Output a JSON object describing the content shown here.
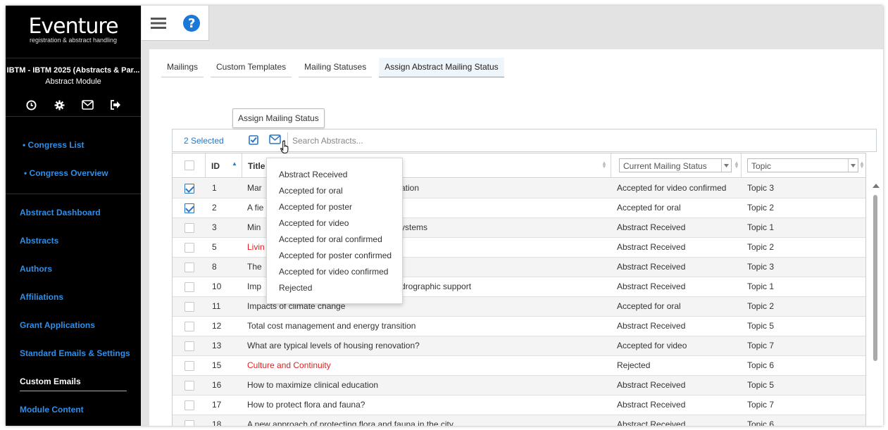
{
  "sidebar": {
    "logo_title": "Eventure",
    "logo_subtitle": "registration & abstract handling",
    "congress_name": "IBTM - IBTM 2025 (Abstracts & Par...",
    "module_name": "Abstract Module",
    "icons": [
      "clock-icon",
      "gear-icon",
      "mail-icon",
      "logout-icon"
    ],
    "links": {
      "congress_list": "• Congress List",
      "congress_overview": "• Congress Overview",
      "abstract_dashboard": "Abstract Dashboard",
      "abstracts": "Abstracts",
      "authors": "Authors",
      "affiliations": "Affiliations",
      "grant_applications": "Grant Applications",
      "standard_emails": "Standard Emails & Settings",
      "custom_emails": "Custom Emails",
      "module_content": "Module Content"
    },
    "active_link": "Custom Emails",
    "link_color": "#2f8fe8"
  },
  "topbar": {
    "icons": [
      "hamburger-icon",
      "help-icon"
    ],
    "help_glyph": "?"
  },
  "tabs": [
    {
      "label": "Mailings",
      "active": false
    },
    {
      "label": "Custom Templates",
      "active": false
    },
    {
      "label": "Mailing Statuses",
      "active": false
    },
    {
      "label": "Assign Abstract Mailing Status",
      "active": true
    }
  ],
  "toolbar": {
    "selected_text": "2 Selected",
    "search_placeholder": "Search Abstracts...",
    "tooltip": "Assign Mailing Status"
  },
  "grid": {
    "columns": {
      "id": "ID",
      "title": "Title",
      "status_filter": "Current Mailing Status",
      "topic_filter": "Topic"
    },
    "rows": [
      {
        "checked": true,
        "id": "1",
        "title": "Mar",
        "title_rest": "zation",
        "red": false,
        "status": "Accepted for video confirmed",
        "topic": "Topic 3"
      },
      {
        "checked": true,
        "id": "2",
        "title": "A fie",
        "title_rest": "",
        "red": false,
        "status": "Accepted for oral",
        "topic": "Topic 2"
      },
      {
        "checked": false,
        "id": "3",
        "title": "Min",
        "title_rest": "systems",
        "red": false,
        "status": "Abstract Received",
        "topic": "Topic 1"
      },
      {
        "checked": false,
        "id": "5",
        "title": "Livin",
        "title_rest": "",
        "red": true,
        "status": "Abstract Received",
        "topic": "Topic 2"
      },
      {
        "checked": false,
        "id": "8",
        "title": "The",
        "title_rest": "",
        "red": false,
        "status": "Abstract Received",
        "topic": "Topic 3"
      },
      {
        "checked": false,
        "id": "10",
        "title": "Imp",
        "title_rest": "ydrographic support",
        "red": false,
        "status": "Abstract Received",
        "topic": "Topic 1"
      },
      {
        "checked": false,
        "id": "11",
        "title": "Impacts of climate change",
        "title_rest": "",
        "red": false,
        "status": "Accepted for oral",
        "topic": "Topic 2"
      },
      {
        "checked": false,
        "id": "12",
        "title": "Total cost management and energy transition",
        "title_rest": "",
        "red": false,
        "status": "Abstract Received",
        "topic": "Topic 5"
      },
      {
        "checked": false,
        "id": "13",
        "title": "What are typical levels of housing renovation?",
        "title_rest": "",
        "red": false,
        "status": "Accepted for video",
        "topic": "Topic 7"
      },
      {
        "checked": false,
        "id": "15",
        "title": "Culture and Continuity",
        "title_rest": "",
        "red": true,
        "status": "Rejected",
        "topic": "Topic 6"
      },
      {
        "checked": false,
        "id": "16",
        "title": "How to maximize clinical education",
        "title_rest": "",
        "red": false,
        "status": "Abstract Received",
        "topic": "Topic 5"
      },
      {
        "checked": false,
        "id": "17",
        "title": "How to protect flora and fauna?",
        "title_rest": "",
        "red": false,
        "status": "Abstract Received",
        "topic": "Topic 7"
      },
      {
        "checked": false,
        "id": "18",
        "title": "A new approach of protecting flora and fauna in the city",
        "title_rest": "",
        "red": false,
        "status": "Abstract Received",
        "topic": "Topic 6"
      }
    ]
  },
  "dropdown": {
    "items": [
      "Abstract Received",
      "Accepted for oral",
      "Accepted for poster",
      "Accepted for video",
      "Accepted for oral confirmed",
      "Accepted for poster confirmed",
      "Accepted for video confirmed",
      "Rejected"
    ]
  },
  "colors": {
    "accent": "#2a76c4",
    "error_red": "#e02020",
    "help_blue": "#1a78d8"
  }
}
